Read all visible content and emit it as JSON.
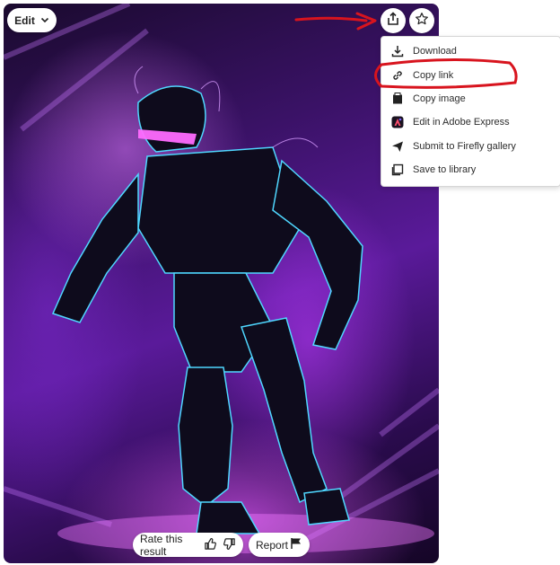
{
  "toolbar": {
    "edit_label": "Edit",
    "share_icon": "share-icon",
    "favorite_icon": "star-icon"
  },
  "share_menu": {
    "items": [
      {
        "label": "Download",
        "icon": "download-icon"
      },
      {
        "label": "Copy link",
        "icon": "link-icon"
      },
      {
        "label": "Copy image",
        "icon": "image-icon"
      },
      {
        "label": "Edit in Adobe Express",
        "icon": "adobe-express-icon"
      },
      {
        "label": "Submit to Firefly gallery",
        "icon": "send-icon"
      },
      {
        "label": "Save to library",
        "icon": "library-icon"
      }
    ]
  },
  "footer": {
    "rate_label": "Rate this result",
    "report_label": "Report"
  },
  "colors": {
    "annotation_red": "#d8141e",
    "image_accent": "#b43cff"
  }
}
